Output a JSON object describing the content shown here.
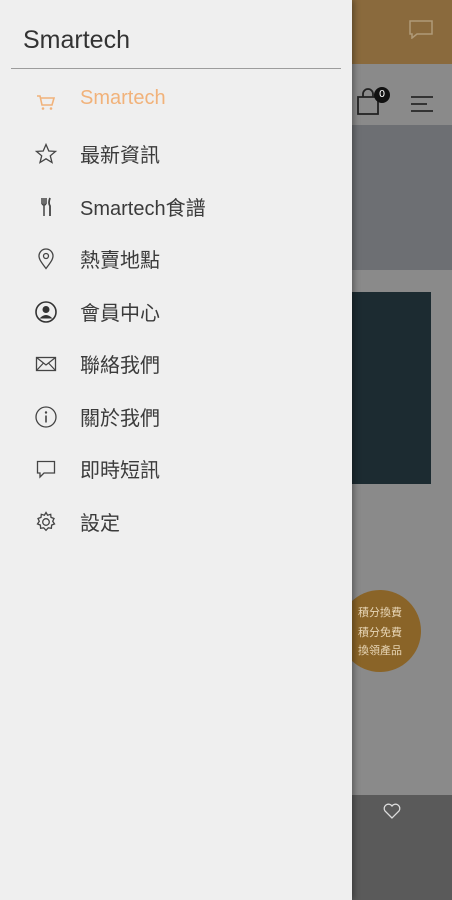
{
  "drawer": {
    "title": "Smartech",
    "items": [
      {
        "label": "Smartech",
        "icon": "cart-icon",
        "active": true
      },
      {
        "label": "最新資訊",
        "icon": "star-icon"
      },
      {
        "label": "Smartech食譜",
        "icon": "cutlery-icon"
      },
      {
        "label": "熱賣地點",
        "icon": "location-pin-icon"
      },
      {
        "label": "會員中心",
        "icon": "user-circle-icon"
      },
      {
        "label": "聯絡我們",
        "icon": "envelope-icon"
      },
      {
        "label": "關於我們",
        "icon": "info-icon"
      },
      {
        "label": "即時短訊",
        "icon": "chat-bubble-icon"
      },
      {
        "label": "設定",
        "icon": "gear-icon"
      }
    ]
  },
  "background": {
    "cart_count": "0",
    "promo_badge": [
      "積分換費",
      "積分免費",
      "換領產品"
    ]
  },
  "colors": {
    "accent": "#f1b27a",
    "drawer_bg": "#efefef",
    "header_bg": "#8a6a3d"
  }
}
